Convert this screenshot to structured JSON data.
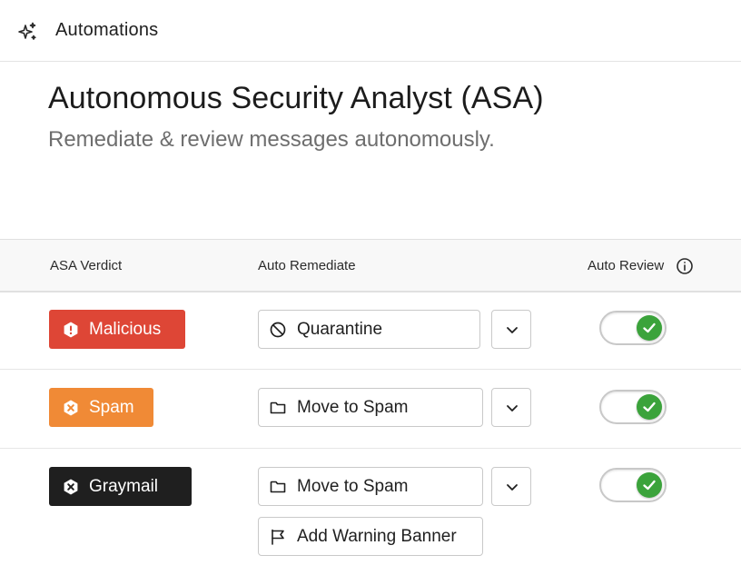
{
  "header": {
    "title": "Automations",
    "icon": "sparkles-icon"
  },
  "page": {
    "title": "Autonomous Security Analyst (ASA)",
    "subtitle": "Remediate & review messages autonomously."
  },
  "table": {
    "columns": {
      "verdict": "ASA Verdict",
      "remediate": "Auto Remediate",
      "review": "Auto Review"
    },
    "rows": [
      {
        "verdict": {
          "label": "Malicious",
          "icon": "exclamation-icon",
          "color": "#de4636"
        },
        "actions": [
          {
            "label": "Quarantine",
            "icon": "block-icon"
          }
        ],
        "auto_review": true
      },
      {
        "verdict": {
          "label": "Spam",
          "icon": "spam-icon",
          "color": "#f08a36"
        },
        "actions": [
          {
            "label": "Move to Spam",
            "icon": "folder-icon"
          }
        ],
        "auto_review": true
      },
      {
        "verdict": {
          "label": "Graymail",
          "icon": "spam-icon",
          "color": "#1f1f1f"
        },
        "actions": [
          {
            "label": "Move to Spam",
            "icon": "folder-icon"
          },
          {
            "label": "Add Warning Banner",
            "icon": "flag-icon"
          }
        ],
        "auto_review": true
      }
    ]
  },
  "colors": {
    "toggle_on": "#3ba33b",
    "malicious": "#de4636",
    "spam": "#f08a36",
    "graymail": "#1f1f1f"
  }
}
